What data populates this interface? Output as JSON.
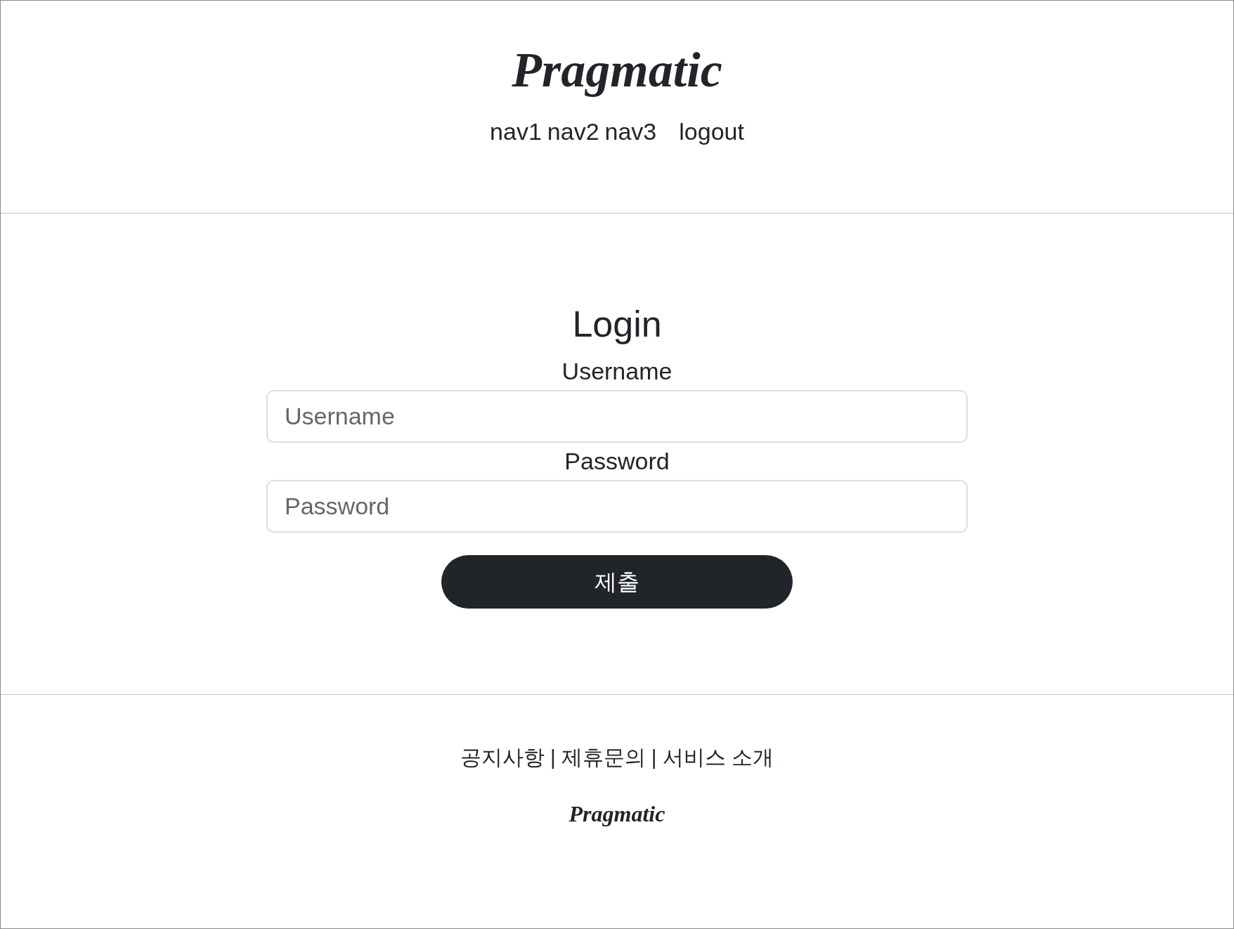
{
  "header": {
    "logo": "Pragmatic",
    "nav": [
      {
        "label": "nav1"
      },
      {
        "label": "nav2"
      },
      {
        "label": "nav3"
      }
    ],
    "logout": "logout"
  },
  "login": {
    "title": "Login",
    "fields": [
      {
        "label": "Username",
        "placeholder": "Username"
      },
      {
        "label": "Password",
        "placeholder": "Password"
      }
    ],
    "submit": "제출"
  },
  "footer": {
    "links": [
      "공지사항",
      "제휴문의",
      "서비스 소개"
    ],
    "separator": "|",
    "logo": "Pragmatic"
  }
}
